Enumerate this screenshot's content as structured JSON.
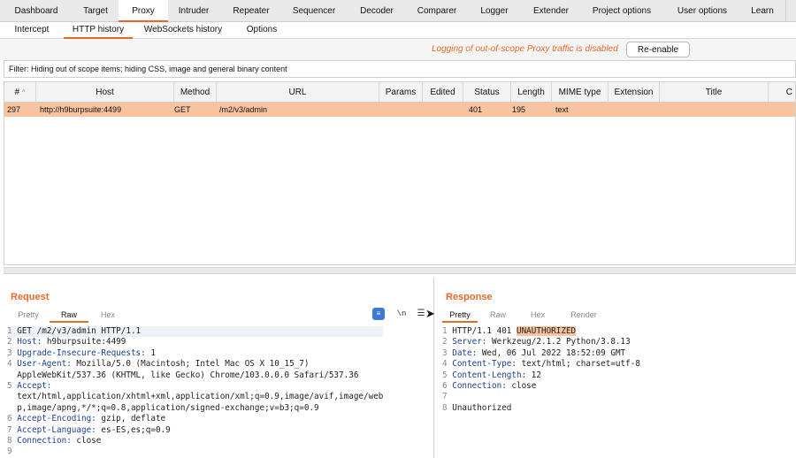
{
  "top_tabs": [
    "Dashboard",
    "Target",
    "Proxy",
    "Intruder",
    "Repeater",
    "Sequencer",
    "Decoder",
    "Comparer",
    "Logger",
    "Extender",
    "Project options",
    "User options",
    "Learn"
  ],
  "active_top_tab": "Proxy",
  "sub_tabs": [
    "Intercept",
    "HTTP history",
    "WebSockets history",
    "Options"
  ],
  "active_sub_tab": "HTTP history",
  "notice": {
    "text": "Logging of out-of-scope Proxy traffic is disabled",
    "button": "Re-enable"
  },
  "filter": "Filter: Hiding out of scope items;  hiding CSS, image and general binary content",
  "table": {
    "columns": [
      "#",
      "Host",
      "Method",
      "URL",
      "Params",
      "Edited",
      "Status",
      "Length",
      "MIME type",
      "Extension",
      "Title",
      "C"
    ],
    "rows": [
      [
        "297",
        "http://h9burpsuite:4499",
        "GET",
        "/m2/v3/admin",
        "",
        "",
        "401",
        "195",
        "text",
        "",
        "",
        ""
      ]
    ]
  },
  "request": {
    "title": "Request",
    "tabs": [
      "Pretty",
      "Raw",
      "Hex"
    ],
    "active_tab": "Raw",
    "tools": {
      "wrap": "≡",
      "newline": "\\n",
      "menu": "☰"
    },
    "lines": [
      {
        "n": "1",
        "name": "",
        "rest": "GET /m2/v3/admin HTTP/1.1"
      },
      {
        "n": "2",
        "name": "Host:",
        "rest": " h9burpsuite:4499"
      },
      {
        "n": "3",
        "name": "Upgrade-Insecure-Requests:",
        "rest": " 1"
      },
      {
        "n": "4",
        "name": "User-Agent:",
        "rest": " Mozilla/5.0 (Macintosh; Intel Mac OS X 10_15_7)"
      },
      {
        "n": "",
        "name": "",
        "rest": "AppleWebKit/537.36 (KHTML, like Gecko) Chrome/103.0.0.0 Safari/537.36"
      },
      {
        "n": "5",
        "name": "Accept:",
        "rest": ""
      },
      {
        "n": "",
        "name": "",
        "rest": "text/html,application/xhtml+xml,application/xml;q=0.9,image/avif,image/web"
      },
      {
        "n": "",
        "name": "",
        "rest": "p,image/apng,*/*;q=0.8,application/signed-exchange;v=b3;q=0.9"
      },
      {
        "n": "6",
        "name": "Accept-Encoding:",
        "rest": " gzip, deflate"
      },
      {
        "n": "7",
        "name": "Accept-Language:",
        "rest": " es-ES,es;q=0.9"
      },
      {
        "n": "8",
        "name": "Connection:",
        "rest": " close"
      },
      {
        "n": "9",
        "name": "",
        "rest": ""
      }
    ]
  },
  "response": {
    "title": "Response",
    "tabs": [
      "Pretty",
      "Raw",
      "Hex",
      "Render"
    ],
    "active_tab": "Pretty",
    "lines": [
      {
        "n": "1",
        "name": "",
        "rest": "HTTP/1.1 401 ",
        "hl": "UNAUTHORIZED"
      },
      {
        "n": "2",
        "name": "Server:",
        "rest": " Werkzeug/2.1.2 Python/3.8.13"
      },
      {
        "n": "3",
        "name": "Date:",
        "rest": " Wed, 06 Jul 2022 18:52:09 GMT"
      },
      {
        "n": "4",
        "name": "Content-Type:",
        "rest": " text/html; charset=utf-8"
      },
      {
        "n": "5",
        "name": "Content-Length:",
        "rest": " 12"
      },
      {
        "n": "6",
        "name": "Connection:",
        "rest": " close"
      },
      {
        "n": "7",
        "name": "",
        "rest": ""
      },
      {
        "n": "8",
        "name": "",
        "rest": "Unauthorized"
      }
    ]
  },
  "colors": {
    "accent": "#e8692a",
    "row_highlight": "#f8c49f",
    "header_name": "#1a3f8a",
    "wrap_button": "#3d7bd6"
  }
}
